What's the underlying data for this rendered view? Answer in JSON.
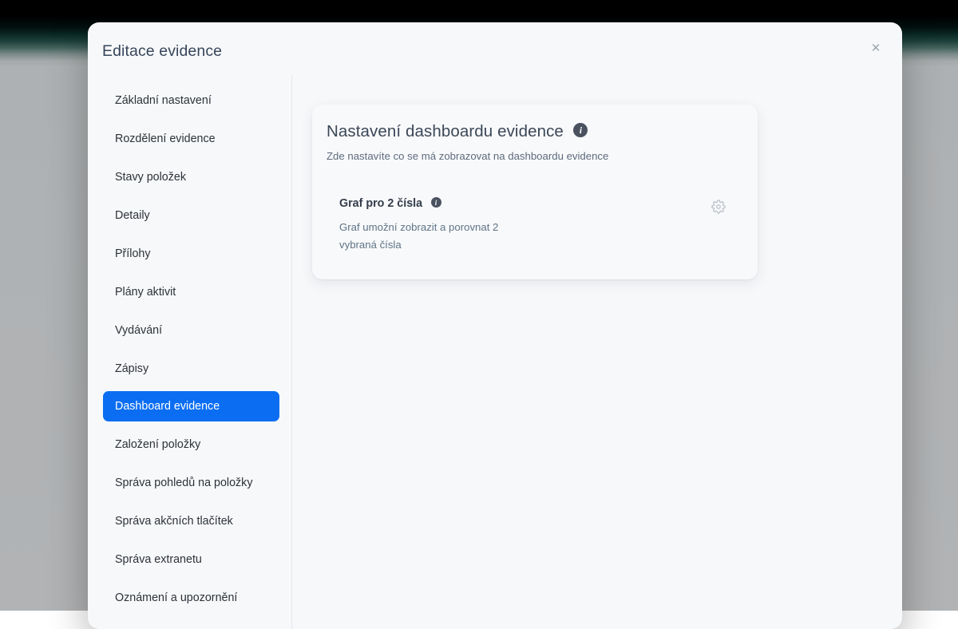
{
  "modal": {
    "title": "Editace evidence",
    "close_label": "×",
    "close_icon": "close-icon"
  },
  "sidebar": {
    "items": [
      {
        "label": "Základní nastavení",
        "active": false
      },
      {
        "label": "Rozdělení evidence",
        "active": false
      },
      {
        "label": "Stavy položek",
        "active": false
      },
      {
        "label": "Detaily",
        "active": false
      },
      {
        "label": "Přílohy",
        "active": false
      },
      {
        "label": "Plány aktivit",
        "active": false
      },
      {
        "label": "Vydávání",
        "active": false
      },
      {
        "label": "Zápisy",
        "active": false
      },
      {
        "label": "Dashboard evidence",
        "active": true
      },
      {
        "label": "Založení položky",
        "active": false
      },
      {
        "label": "Správa pohledů na položky",
        "active": false
      },
      {
        "label": "Správa akčních tlačítek",
        "active": false
      },
      {
        "label": "Správa extranetu",
        "active": false
      },
      {
        "label": "Oznámení a upozornění",
        "active": false
      }
    ]
  },
  "card": {
    "title": "Nastavení dashboardu evidence",
    "title_info_icon": "info-icon",
    "subtitle": "Zde nastavíte co se má zobrazovat na dashboardu evidence",
    "widgets": [
      {
        "title": "Graf pro 2 čísla",
        "info_icon": "info-icon",
        "description": "Graf umožní zobrazit a porovnat 2 vybraná čísla",
        "settings_icon": "gear-icon"
      }
    ]
  },
  "colors": {
    "accent": "#0b6ef2",
    "title_text": "#37465b",
    "body_text": "#2c3238",
    "muted_text": "#5f7486",
    "card_bg": "#f8f9fb",
    "modal_bg": "#f7f8fa",
    "info_badge": "#4a5260",
    "gear": "#b9bfc8"
  }
}
